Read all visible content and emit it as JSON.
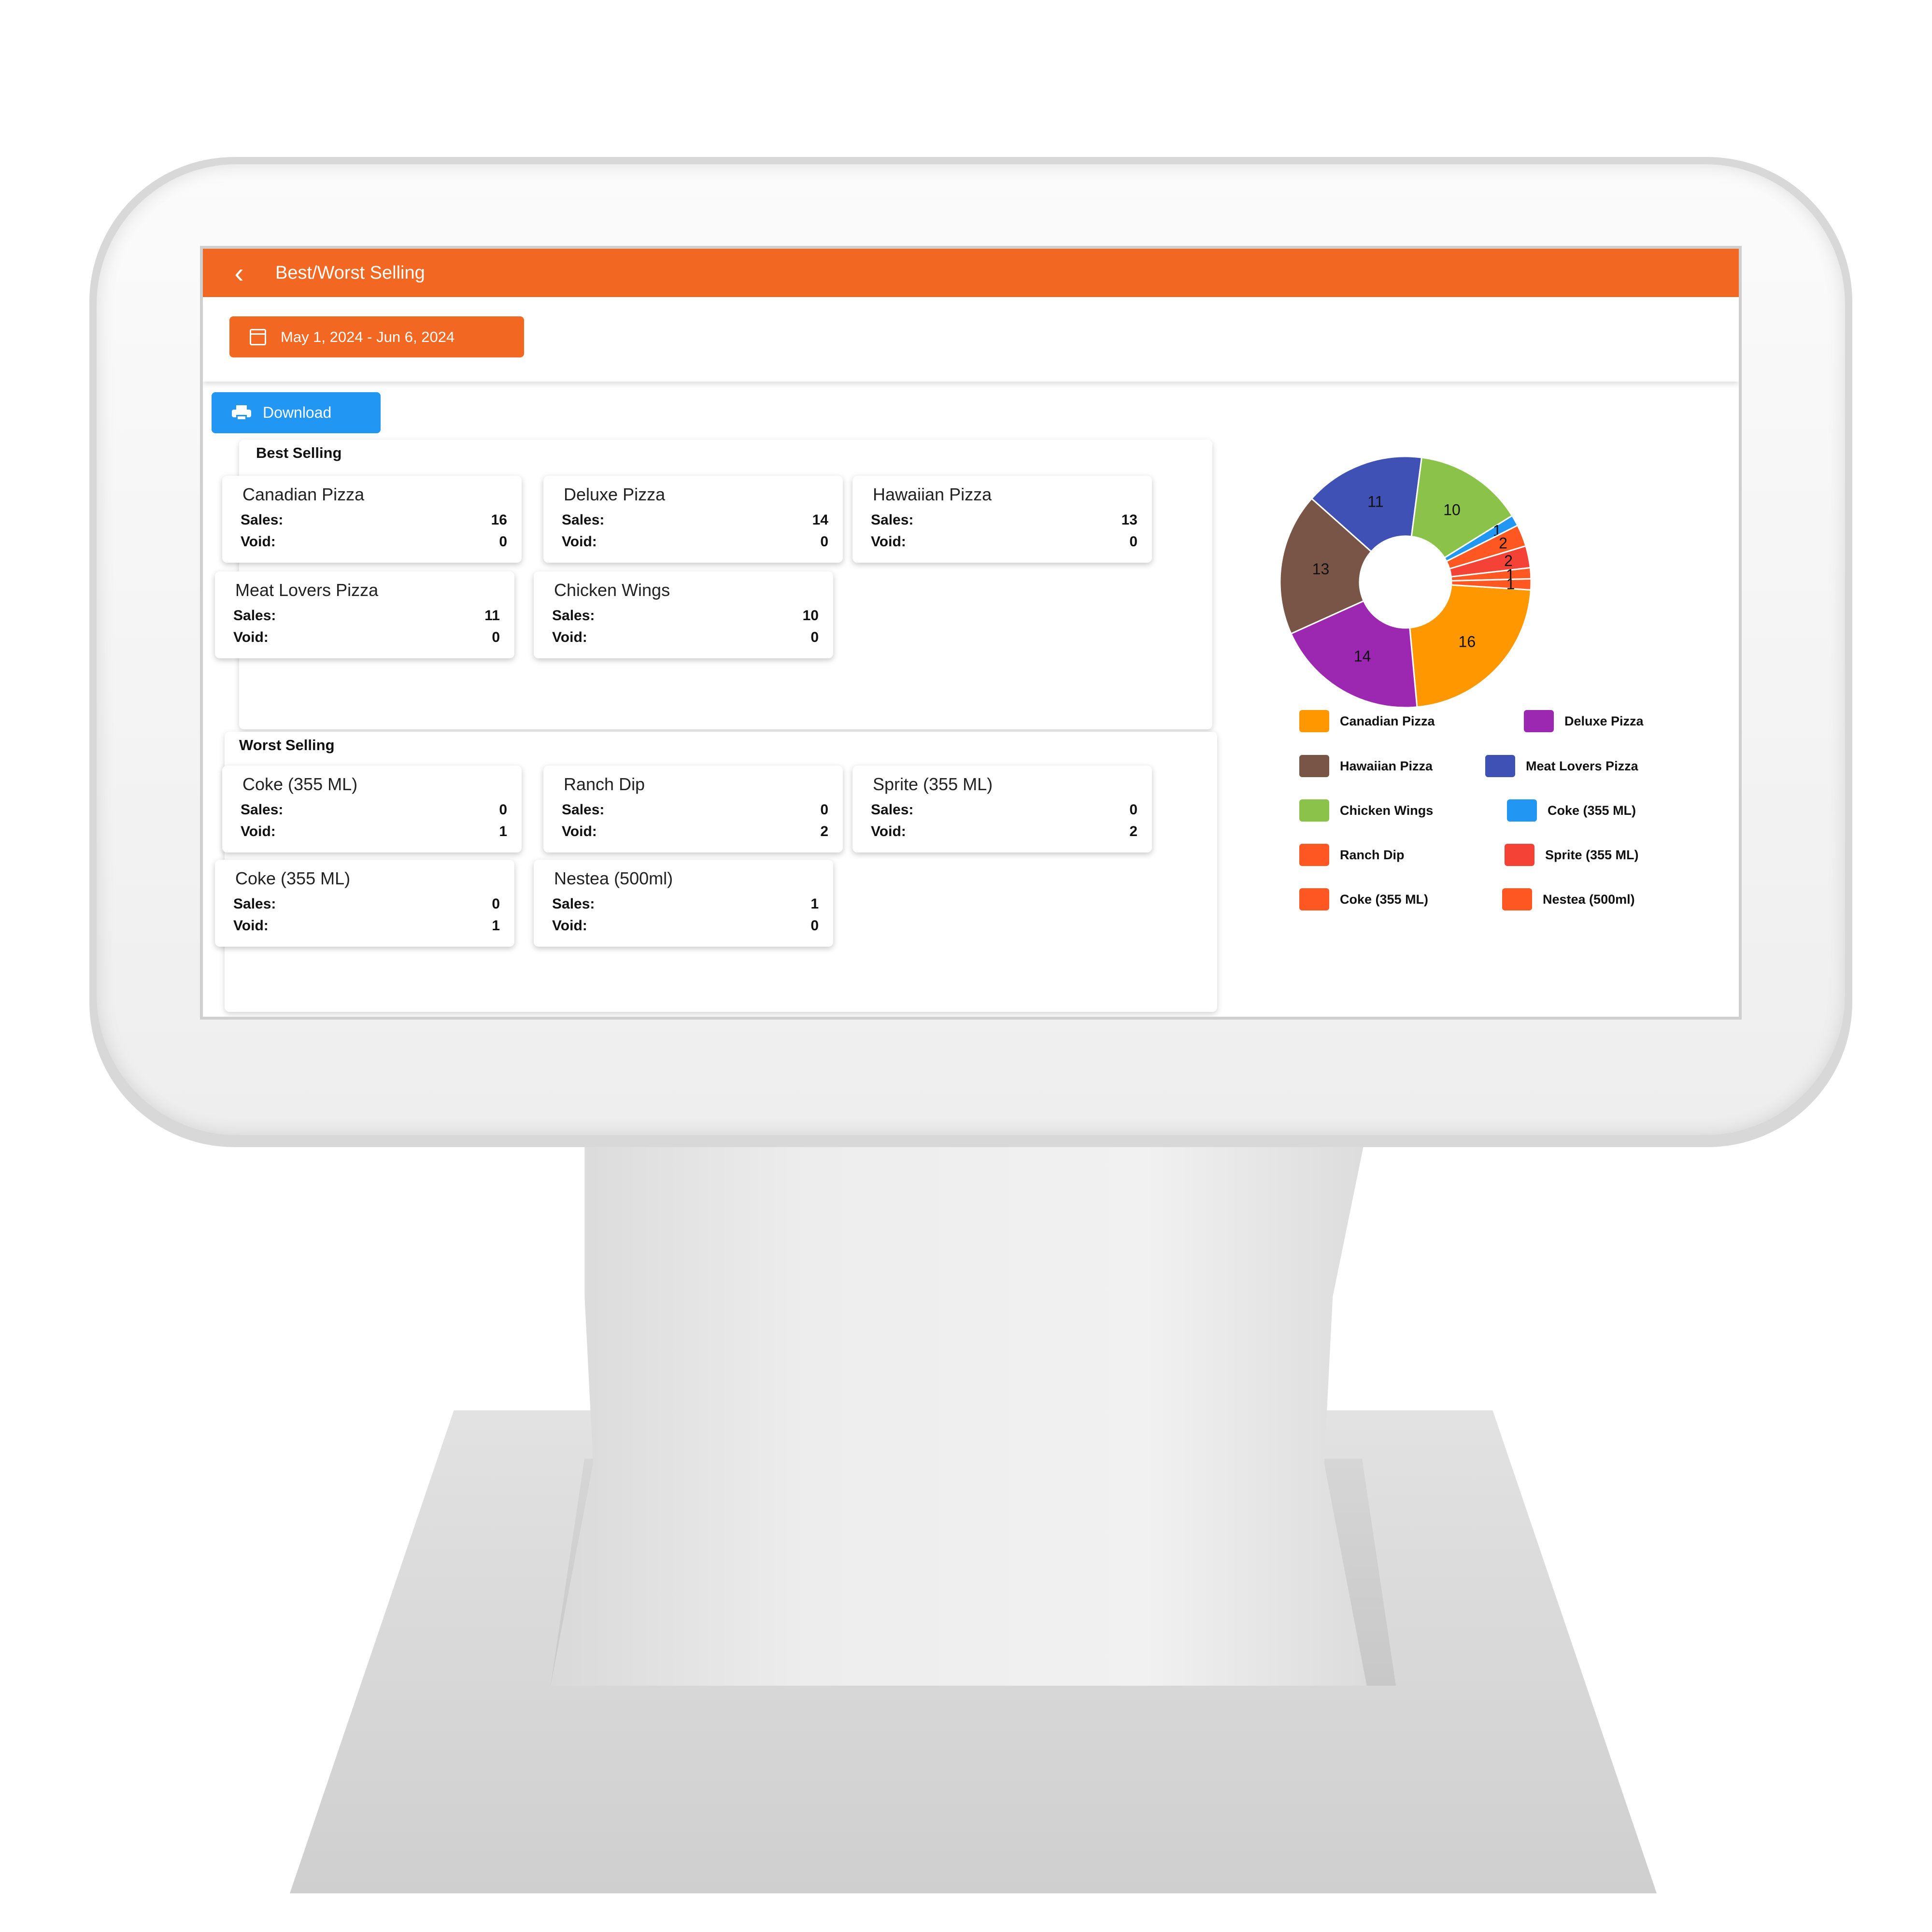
{
  "header": {
    "title": "Best/Worst Selling",
    "back_icon": "‹"
  },
  "filter": {
    "date_range": "May 1, 2024 - Jun 6, 2024"
  },
  "toolbar": {
    "download_label": "Download"
  },
  "best": {
    "title": "Best Selling",
    "items": [
      {
        "name": "Canadian Pizza",
        "sales": "16",
        "void": "0"
      },
      {
        "name": "Deluxe Pizza",
        "sales": "14",
        "void": "0"
      },
      {
        "name": "Hawaiian Pizza",
        "sales": "13",
        "void": "0"
      },
      {
        "name": "Meat Lovers Pizza",
        "sales": "11",
        "void": "0"
      },
      {
        "name": "Chicken Wings",
        "sales": "10",
        "void": "0"
      }
    ]
  },
  "worst": {
    "title": "Worst Selling",
    "items": [
      {
        "name": "Coke (355 ML)",
        "sales": "0",
        "void": "1"
      },
      {
        "name": "Ranch Dip",
        "sales": "0",
        "void": "2"
      },
      {
        "name": "Sprite (355 ML)",
        "sales": "0",
        "void": "2"
      },
      {
        "name": "Coke (355 ML)",
        "sales": "0",
        "void": "1"
      },
      {
        "name": "Nestea (500ml)",
        "sales": "1",
        "void": "0"
      }
    ]
  },
  "labels": {
    "sales": "Sales:",
    "void": "Void:"
  },
  "colors": {
    "accent": "#f26722",
    "download": "#2196f3"
  },
  "chart_data": {
    "type": "pie",
    "slices": [
      {
        "label": "Canadian Pizza",
        "value": 16,
        "color": "#ff9800"
      },
      {
        "label": "Deluxe Pizza",
        "value": 14,
        "color": "#9c27b0"
      },
      {
        "label": "Hawaiian Pizza",
        "value": 13,
        "color": "#795548"
      },
      {
        "label": "Meat Lovers Pizza",
        "value": 11,
        "color": "#3f51b5"
      },
      {
        "label": "Chicken Wings",
        "value": 10,
        "color": "#8bc34a"
      },
      {
        "label": "Coke (355 ML)",
        "value": 1,
        "color": "#2196f3"
      },
      {
        "label": "Ranch Dip",
        "value": 2,
        "color": "#ff5722"
      },
      {
        "label": "Sprite (355 ML)",
        "value": 2,
        "color": "#f44336"
      },
      {
        "label": "Coke (355 ML)",
        "value": 1,
        "color": "#ff5722"
      },
      {
        "label": "Nestea (500ml)",
        "value": 1,
        "color": "#ff5722"
      }
    ],
    "legend": [
      {
        "label": "Canadian Pizza",
        "color": "#ff9800"
      },
      {
        "label": "Deluxe Pizza",
        "color": "#9c27b0"
      },
      {
        "label": "Hawaiian Pizza",
        "color": "#795548"
      },
      {
        "label": "Meat Lovers Pizza",
        "color": "#3f51b5"
      },
      {
        "label": "Chicken Wings",
        "color": "#8bc34a"
      },
      {
        "label": "Coke (355 ML)",
        "color": "#2196f3"
      },
      {
        "label": "Ranch Dip",
        "color": "#ff5722"
      },
      {
        "label": "Sprite (355 ML)",
        "color": "#f44336"
      },
      {
        "label": "Coke (355 ML)",
        "color": "#ff5722"
      },
      {
        "label": "Nestea (500ml)",
        "color": "#ff5722"
      }
    ]
  }
}
